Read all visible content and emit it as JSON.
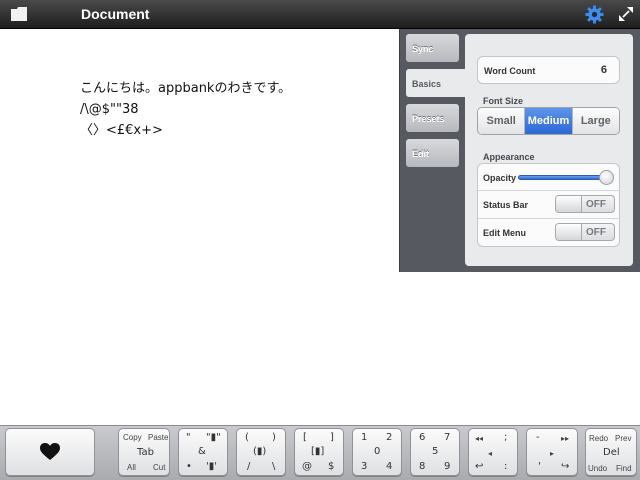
{
  "header": {
    "title": "Document",
    "icons": [
      "folder-icon",
      "gear-icon",
      "resize-icon"
    ]
  },
  "document": {
    "lines": [
      "こんにちは。appbankのわきです。",
      "/\\@$\"\"38",
      "〈〉<£€x+>"
    ]
  },
  "settings": {
    "tabs": [
      "Sync",
      "Basics",
      "Presets",
      "Edit"
    ],
    "active_tab": "Basics",
    "word_count": {
      "label": "Word Count",
      "value": "6"
    },
    "font_size": {
      "label": "Font Size",
      "options": [
        "Small",
        "Medium",
        "Large"
      ],
      "selected": "Medium"
    },
    "appearance": {
      "label": "Appearance",
      "opacity": {
        "label": "Opacity",
        "value": 1.0
      },
      "status_bar": {
        "label": "Status Bar",
        "state": "OFF"
      },
      "edit_menu": {
        "label": "Edit Menu",
        "state": "OFF"
      }
    }
  },
  "keyboard": {
    "copy": "Copy",
    "paste": "Paste",
    "tab": "Tab",
    "all": "All",
    "cut": "Cut",
    "k2": {
      "tl": "\"",
      "tr": "\"▮\"",
      "c": "&",
      "bl": "•",
      "br": "'▮'"
    },
    "k3": {
      "tl": "(",
      "tr": ")",
      "c": "(▮)",
      "bl": "/",
      "br": "\\"
    },
    "k4": {
      "tl": "[",
      "tr": "]",
      "c": "[▮]",
      "bl": "@",
      "br": "$"
    },
    "k5": {
      "tl": "1",
      "tr": "2",
      "c": "0",
      "bl": "3",
      "br": "4"
    },
    "k6": {
      "tl": "6",
      "tr": "7",
      "c": "5",
      "bl": "8",
      "br": "9"
    },
    "k7": {
      "tl": "◂◂",
      "tr": ";",
      "c": "◂",
      "bl": "↩",
      "br": ":"
    },
    "k8": {
      "tl": "-",
      "tr": "▸▸",
      "c": "▸",
      "bl": "'",
      "br": "↪"
    },
    "redo": "Redo",
    "prev": "Prev",
    "del": "Del",
    "undo": "Undo",
    "find": "Find"
  },
  "colors": {
    "accent": "#2c67d4",
    "panel": "#565a60",
    "topbar": "#2a2a2a"
  }
}
